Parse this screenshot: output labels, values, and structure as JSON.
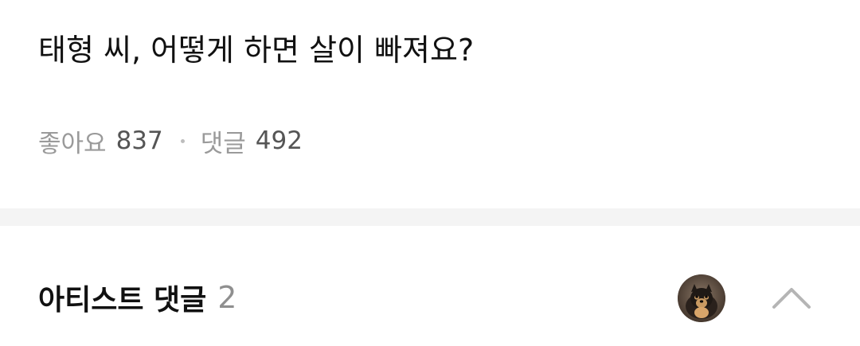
{
  "post": {
    "text": "태형 씨, 어떻게 하면 살이 빠져요?",
    "stats": {
      "likes_label": "좋아요",
      "likes_count": "837",
      "comments_label": "댓글",
      "comments_count": "492"
    }
  },
  "artist_comments": {
    "title": "아티스트 댓글",
    "count": "2",
    "avatar_icon": "dog-avatar",
    "collapse_icon": "chevron-up-icon"
  }
}
